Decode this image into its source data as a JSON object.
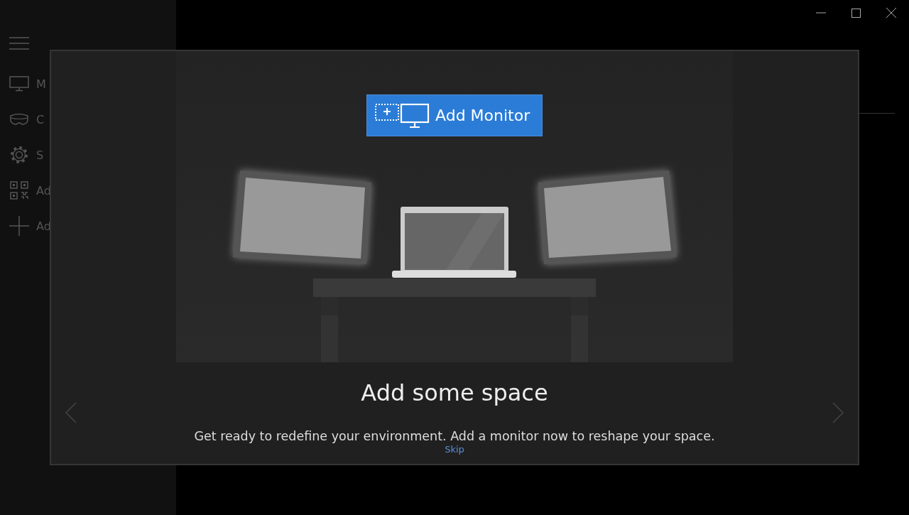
{
  "sidebar": {
    "items": [
      {
        "kind": "monitor",
        "label": "M"
      },
      {
        "kind": "headset",
        "label": "C"
      },
      {
        "kind": "settings",
        "label": "S"
      },
      {
        "kind": "qr",
        "label": "Ad"
      },
      {
        "kind": "plus",
        "label": "Ad"
      }
    ]
  },
  "dialog": {
    "button": "Add Monitor",
    "title": "Add some space",
    "body": "Get ready to redefine your environment. Add a monitor now to reshape your space.",
    "link": "Skip"
  }
}
